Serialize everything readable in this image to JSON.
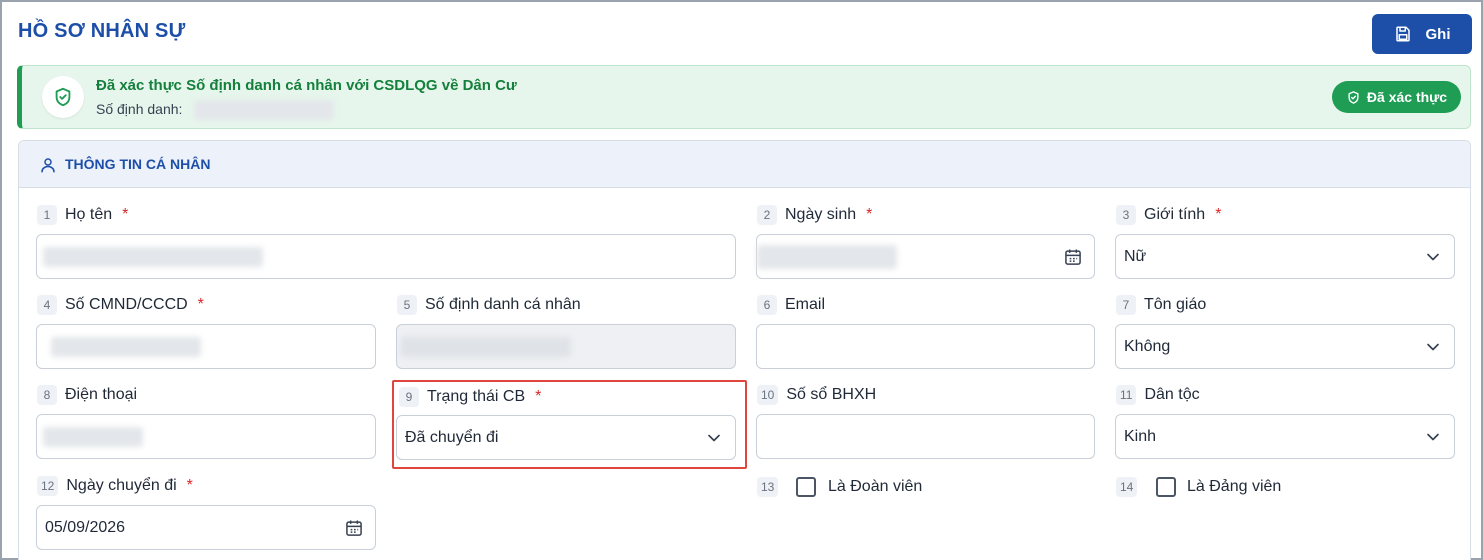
{
  "page": {
    "title": "HỒ SƠ NHÂN SỰ",
    "save_label": "Ghi"
  },
  "verification": {
    "title": "Đã xác thực Số định danh cá nhân với CSDLQG về Dân Cư",
    "id_label": "Số định danh:",
    "status_label": "Đã xác thực",
    "color": "#1f9d55"
  },
  "section": {
    "title": "THÔNG TIN CÁ NHÂN",
    "icon": "user-icon"
  },
  "fields": {
    "ho_ten": {
      "num": "1",
      "label": "Họ tên",
      "required": "*"
    },
    "ngay_sinh": {
      "num": "2",
      "label": "Ngày sinh",
      "required": "*"
    },
    "gioi_tinh": {
      "num": "3",
      "label": "Giới tính",
      "required": "*",
      "value": "Nữ"
    },
    "cmnd": {
      "num": "4",
      "label": "Số CMND/CCCD",
      "required": "*"
    },
    "dinh_danh": {
      "num": "5",
      "label": "Số định danh cá nhân"
    },
    "email": {
      "num": "6",
      "label": "Email"
    },
    "ton_giao": {
      "num": "7",
      "label": "Tôn giáo",
      "value": "Không"
    },
    "dien_thoai": {
      "num": "8",
      "label": "Điện thoại"
    },
    "trang_thai": {
      "num": "9",
      "label": "Trạng thái CB",
      "required": "*",
      "value": "Đã chuyển đi"
    },
    "so_bhxh": {
      "num": "10",
      "label": "Số sổ BHXH"
    },
    "dan_toc": {
      "num": "11",
      "label": "Dân tộc",
      "value": "Kinh"
    },
    "ngay_chuyen_di": {
      "num": "12",
      "label": "Ngày chuyển đi",
      "required": "*",
      "value": "05/09/2026"
    },
    "doan_vien": {
      "num": "13",
      "label": "Là Đoàn viên",
      "checked": false
    },
    "dang_vien": {
      "num": "14",
      "label": "Là Đảng viên",
      "checked": false
    }
  },
  "colors": {
    "primary": "#1d4fa8",
    "success": "#1f9d55",
    "required": "#dc2626",
    "highlight": "#e0463c"
  }
}
